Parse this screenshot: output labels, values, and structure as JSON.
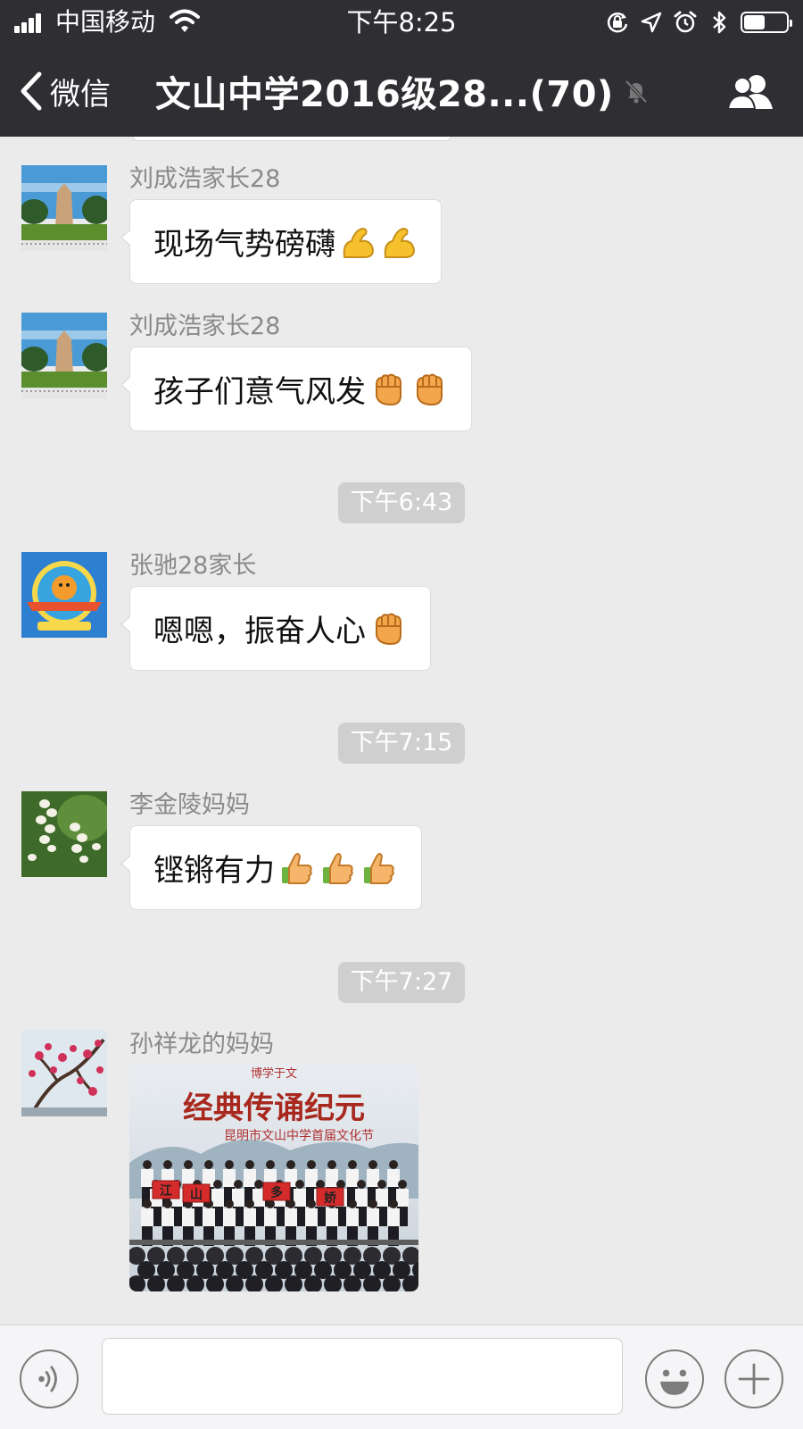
{
  "status_bar": {
    "carrier": "中国移动",
    "time": "下午8:25",
    "battery_level": 0.5
  },
  "nav": {
    "back_label": "微信",
    "title": "文山中学2016级28...(70)",
    "muted": true
  },
  "messages": [
    {
      "type": "text",
      "sender": "刘成浩家长28",
      "text": "现场气势磅礴",
      "emoji": [
        "flexed-biceps-icon",
        "flexed-biceps-icon"
      ],
      "avatar": "monument-avatar"
    },
    {
      "type": "text",
      "sender": "刘成浩家长28",
      "text": "孩子们意气风发",
      "emoji": [
        "raised-fist-icon",
        "raised-fist-icon"
      ],
      "avatar": "monument-avatar"
    },
    {
      "type": "time",
      "text": "下午6:43"
    },
    {
      "type": "text",
      "sender": "张驰28家长",
      "text": "嗯嗯，振奋人心",
      "emoji": [
        "raised-fist-icon"
      ],
      "avatar": "badge-avatar"
    },
    {
      "type": "time",
      "text": "下午7:15"
    },
    {
      "type": "text",
      "sender": "李金陵妈妈",
      "text": "铿锵有力",
      "emoji": [
        "thumbs-up-icon",
        "thumbs-up-icon",
        "thumbs-up-icon"
      ],
      "avatar": "flowers-avatar"
    },
    {
      "type": "time",
      "text": "下午7:27"
    },
    {
      "type": "image",
      "sender": "孙祥龙的妈妈",
      "avatar": "plum-blossom-avatar",
      "image_banner": "经典传诵纪元",
      "image_subbanner": "昆明市文山中学首届文化节",
      "image_top": "博学于文",
      "image_signs": [
        "江",
        "山",
        "多",
        "娇"
      ]
    }
  ],
  "input_bar": {
    "placeholder": ""
  },
  "colors": {
    "nav_bg": "#2e2e33",
    "chat_bg": "#ebebeb",
    "timestamp_pill": "#cfcfcf"
  }
}
